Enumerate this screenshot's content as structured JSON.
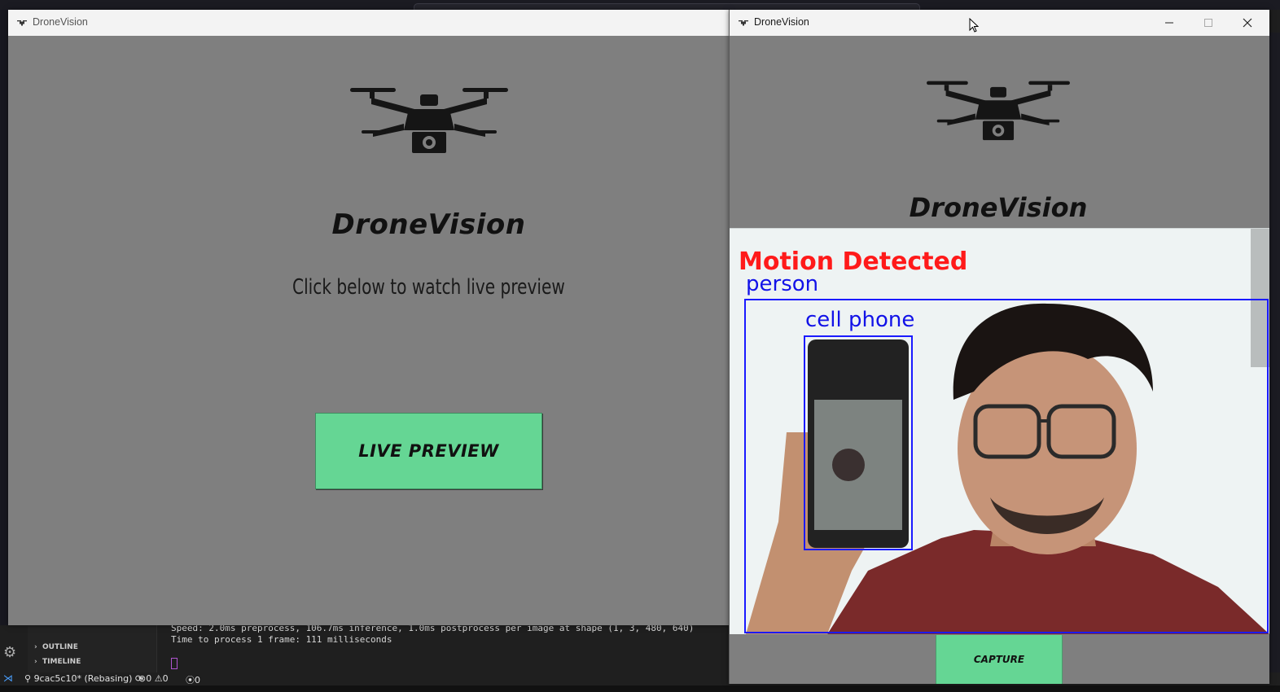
{
  "ide": {
    "outline_label": "OUTLINE",
    "timeline_label": "TIMELINE",
    "terminal_lines": [
      "Speed: 2.0ms preprocess, 106.7ms inference, 1.0ms postprocess per image at shape (1, 3, 480, 640)",
      "Time to process 1 frame: 111 milliseconds"
    ],
    "status": {
      "branch": "9cac5c10* (Rebasing)",
      "errors": "0",
      "warnings": "0",
      "ports": "0"
    }
  },
  "window_main": {
    "title": "DroneVision",
    "brand": "DroneVision",
    "subtitle": "Click below to watch live preview",
    "live_preview_button": "LIVE PREVIEW"
  },
  "window_preview": {
    "title": "DroneVision",
    "brand": "DroneVision",
    "overlay": {
      "motion_text": "Motion Detected",
      "detections": [
        {
          "label": "person"
        },
        {
          "label": "cell phone"
        }
      ]
    },
    "capture_button": "CAPTURE"
  },
  "colors": {
    "button_green": "#65d694",
    "motion_red": "#ff1a1a",
    "detection_blue": "#1a1aff",
    "window_bg": "#7f7f7f"
  }
}
